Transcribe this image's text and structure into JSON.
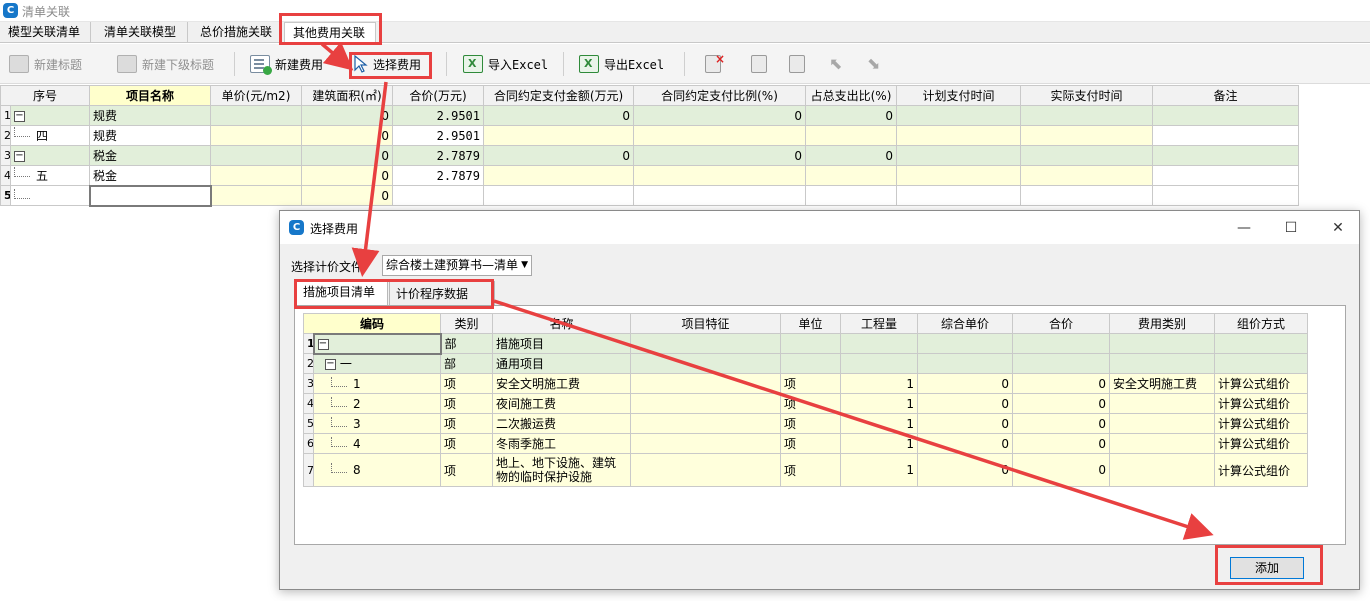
{
  "app": {
    "title": "清单关联",
    "icon": "app-logo-icon"
  },
  "tabs": [
    {
      "label": "模型关联清单",
      "active": false
    },
    {
      "label": "清单关联模型",
      "active": false
    },
    {
      "label": "总价措施关联",
      "active": false
    },
    {
      "label": "其他费用关联",
      "active": true
    }
  ],
  "toolbar": {
    "new_title": "新建标题",
    "new_sub_title": "新建下级标题",
    "new_fee": "新建费用",
    "select_fee": "选择费用",
    "import_excel": "导入Excel",
    "export_excel": "导出Excel"
  },
  "main_grid": {
    "columns": [
      "序号",
      "项目名称",
      "单价(元/m2)",
      "建筑面积(㎡)",
      "合价(万元)",
      "合同约定支付金额(万元)",
      "合同约定支付比例(%)",
      "占总支出比(%)",
      "计划支付时间",
      "实际支付时间",
      "备注"
    ],
    "rows": [
      {
        "rownum": "1",
        "seq": "",
        "name": "规费",
        "unit_price": "",
        "area": "0",
        "total": "2.9501",
        "contract_amount": "0",
        "contract_ratio": "0",
        "share": "0",
        "plan_time": "",
        "actual_time": "",
        "note": ""
      },
      {
        "rownum": "2",
        "seq": "四",
        "name": "规费",
        "unit_price": "",
        "area": "0",
        "total": "2.9501",
        "contract_amount": "",
        "contract_ratio": "",
        "share": "",
        "plan_time": "",
        "actual_time": "",
        "note": ""
      },
      {
        "rownum": "3",
        "seq": "",
        "name": "税金",
        "unit_price": "",
        "area": "0",
        "total": "2.7879",
        "contract_amount": "0",
        "contract_ratio": "0",
        "share": "0",
        "plan_time": "",
        "actual_time": "",
        "note": ""
      },
      {
        "rownum": "4",
        "seq": "五",
        "name": "税金",
        "unit_price": "",
        "area": "0",
        "total": "2.7879",
        "contract_amount": "",
        "contract_ratio": "",
        "share": "",
        "plan_time": "",
        "actual_time": "",
        "note": ""
      },
      {
        "rownum": "5",
        "seq": "",
        "name": "",
        "unit_price": "",
        "area": "0",
        "total": "",
        "contract_amount": "",
        "contract_ratio": "",
        "share": "",
        "plan_time": "",
        "actual_time": "",
        "note": ""
      }
    ]
  },
  "dialog": {
    "title": "选择费用",
    "file_label": "选择计价文件",
    "file_value": "综合楼土建预算书—清单",
    "tabs": [
      {
        "label": "措施项目清单",
        "active": true
      },
      {
        "label": "计价程序数据",
        "active": false
      }
    ],
    "columns": [
      "编码",
      "类别",
      "名称",
      "项目特征",
      "单位",
      "工程量",
      "综合单价",
      "合价",
      "费用类别",
      "组价方式"
    ],
    "rows": [
      {
        "rownum": "1",
        "code": "",
        "cat": "部",
        "name": "措施项目",
        "feature": "",
        "unit": "",
        "qty": "",
        "price": "",
        "total": "",
        "fee_cat": "",
        "method": ""
      },
      {
        "rownum": "2",
        "code": "一",
        "cat": "部",
        "name": "通用项目",
        "feature": "",
        "unit": "",
        "qty": "",
        "price": "",
        "total": "",
        "fee_cat": "",
        "method": ""
      },
      {
        "rownum": "3",
        "code": "1",
        "cat": "项",
        "name": "安全文明施工费",
        "feature": "",
        "unit": "项",
        "qty": "1",
        "price": "0",
        "total": "0",
        "fee_cat": "安全文明施工费",
        "method": "计算公式组价"
      },
      {
        "rownum": "4",
        "code": "2",
        "cat": "项",
        "name": "夜间施工费",
        "feature": "",
        "unit": "项",
        "qty": "1",
        "price": "0",
        "total": "0",
        "fee_cat": "",
        "method": "计算公式组价"
      },
      {
        "rownum": "5",
        "code": "3",
        "cat": "项",
        "name": "二次搬运费",
        "feature": "",
        "unit": "项",
        "qty": "1",
        "price": "0",
        "total": "0",
        "fee_cat": "",
        "method": "计算公式组价"
      },
      {
        "rownum": "6",
        "code": "4",
        "cat": "项",
        "name": "冬雨季施工",
        "feature": "",
        "unit": "项",
        "qty": "1",
        "price": "0",
        "total": "0",
        "fee_cat": "",
        "method": "计算公式组价"
      },
      {
        "rownum": "7",
        "code": "8",
        "cat": "项",
        "name": "地上、地下设施、建筑物的临时保护设施",
        "feature": "",
        "unit": "项",
        "qty": "1",
        "price": "0",
        "total": "0",
        "fee_cat": "",
        "method": "计算公式组价"
      }
    ],
    "add_button": "添加"
  },
  "colors": {
    "annotation": "#e84040",
    "group_row": "#e2efda",
    "editable_cell": "#ffffdc",
    "header_key": "#ffffcc",
    "accent": "#1677c9"
  }
}
